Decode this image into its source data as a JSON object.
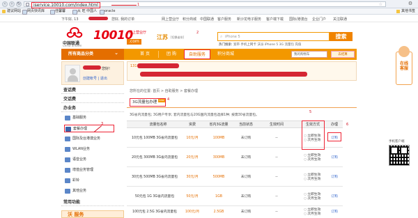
{
  "browser": {
    "url": "iservice.10010.com/index.html",
    "bookmarks": [
      "建议网站",
      "网页快讯库",
      "佳馨馨",
      "从 旺 中国人",
      "oracle"
    ],
    "other_bookmarks": "其他书签"
  },
  "topstrip": {
    "greeting": "下午好, 13",
    "suffix": "您好, 我的订单",
    "links": [
      "我的订单",
      "网上营业厅",
      "积分商城",
      "中国联通",
      "客户服务",
      "新沙龙电子服务",
      "客户端下载",
      "国际/港澳台",
      "企业门户",
      "关注联通"
    ]
  },
  "header": {
    "brand_cn": "中国联通",
    "brand_en": "China unicom",
    "site_number": "10010",
    "site_com": ".com",
    "site_sub_1": "网上营业厅",
    "site_sub_2": "10010.com",
    "region": "江苏",
    "region_switch": "[切换省份]",
    "search_placeholder": "iPhone 5",
    "search_button": "搜索",
    "hot_label": "热门搜索:",
    "hot_terms": "宽带  手机上网卡  沃派  iPhone 5  3G  流量包  充值"
  },
  "nav": {
    "category": "所有商品分类",
    "items": [
      "首 页",
      "团 购",
      "自助服务",
      "积分商城"
    ],
    "active_index": 2,
    "order_select": "我的购物车",
    "cart": "去结算"
  },
  "user": {
    "greeting": "您好!",
    "links": "创建帐号 | 退出"
  },
  "sidebar": {
    "sections": [
      "查话费",
      "交话费",
      "办业务",
      "常用功能"
    ],
    "items": [
      "基础服务",
      "套餐办理",
      "国际及台港澳业务",
      "WLAN业务",
      "语音业务",
      "增值业务管理",
      "彩铃",
      "其他业务"
    ],
    "highlight_index": 1,
    "promo": "沃 服务"
  },
  "main": {
    "account_prefix": "131",
    "breadcrumb": "您所在的位置: 首页 > 自助服务 > 套餐办理",
    "tab_label": "3G流量包办理",
    "tab_badge": "new",
    "description": "3G省内流量包; 3G用户专享; 套内流量包与20G国内流量包选择1种; 按需30省流量包。",
    "columns": [
      "流量包名称",
      "资费",
      "省内3G流量",
      "当前状态",
      "生效时间",
      "生效方式",
      "办理"
    ],
    "rows": [
      {
        "name": "10元包 100MB 3G省内流量包",
        "price": "10元/月",
        "traffic": "100MB",
        "status": "未订购",
        "time": "--",
        "modes": [
          "立即生效",
          "次月生效"
        ],
        "action": "订购"
      },
      {
        "name": "20元包 300MB 3G省内流量包",
        "price": "20元/月",
        "traffic": "300MB",
        "status": "未订购",
        "time": "--",
        "modes": [
          "立即生效",
          "次月生效"
        ],
        "action": "订购"
      },
      {
        "name": "30元包 500MB 3G省内流量包",
        "price": "30元/月",
        "traffic": "500MB",
        "status": "未订购",
        "time": "--",
        "modes": [
          "立即生效",
          "次月生效"
        ],
        "action": "订购"
      },
      {
        "name": "50元包 1G 3G省内流量包",
        "price": "50元/月",
        "traffic": "1GB",
        "status": "未订购",
        "time": "--",
        "modes": [
          "立即生效",
          "次月生效"
        ],
        "action": "订购"
      },
      {
        "name": "100元包 2.5G 3G省内流量包",
        "price": "100元/月",
        "traffic": "2.5GB",
        "status": "未订购",
        "time": "--",
        "modes": [
          "立即生效",
          "次月生效"
        ],
        "action": "订购"
      }
    ]
  },
  "annotations": [
    "1",
    "2",
    "3",
    "4",
    "5",
    "6"
  ],
  "float": {
    "service": "在线客服",
    "qr_label": "手机客户端"
  },
  "colors": {
    "brand_red": "#e60012",
    "brand_orange": "#f39800",
    "annotation_red": "#d01020"
  }
}
